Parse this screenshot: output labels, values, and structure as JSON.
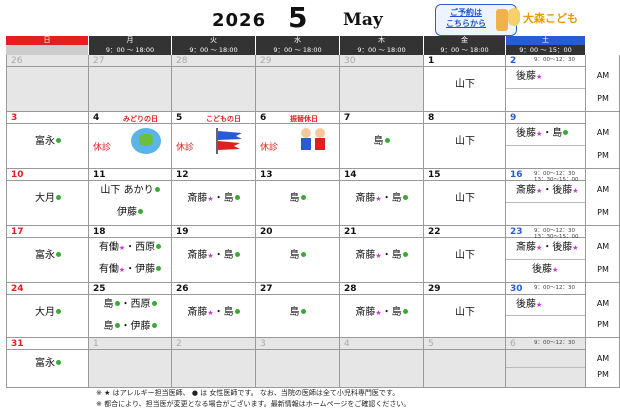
{
  "header": {
    "year": "2026",
    "month_num": "5",
    "month_name": "May",
    "reserve_text": "ご予約は\nこちらから",
    "logo_text": "大森こども"
  },
  "days": [
    "日",
    "月",
    "火",
    "水",
    "木",
    "金",
    "土"
  ],
  "times": [
    "",
    "9：00 ～ 18:00",
    "9：00 ～ 18:00",
    "9：00 ～ 18:00",
    "9：00 ～ 18:00",
    "9：00 ～ 18:00",
    "9：00 ～ 15：00"
  ],
  "ampm": {
    "am": "AM",
    "pm": "PM"
  },
  "weeks": [
    {
      "dates": [
        "26",
        "27",
        "28",
        "29",
        "30",
        "1",
        "2"
      ],
      "grey": [
        1,
        1,
        1,
        1,
        1,
        0,
        0
      ],
      "am": [
        "",
        "",
        "",
        "",
        "",
        "山下",
        ""
      ],
      "pm": [
        "",
        "",
        "",
        "",
        "",
        "",
        ""
      ],
      "sat_am": "後藤",
      "sat_pm": ""
    },
    {
      "dates": [
        "3",
        "4",
        "5",
        "6",
        "7",
        "8",
        "9"
      ],
      "grey": [
        0,
        0,
        0,
        0,
        0,
        0,
        0
      ],
      "am": [
        "富永",
        "",
        "",
        "",
        "島",
        "山下",
        ""
      ],
      "pm": [
        "",
        "",
        "",
        "",
        "",
        "",
        ""
      ],
      "sat_am": "後藤・島",
      "sat_pm": ""
    },
    {
      "dates": [
        "10",
        "11",
        "12",
        "13",
        "14",
        "15",
        "16"
      ],
      "grey": [
        0,
        0,
        0,
        0,
        0,
        0,
        0
      ],
      "am": [
        "大月",
        "山下 あかり",
        "斎藤・島",
        "島",
        "斎藤・島",
        "山下",
        ""
      ],
      "pm": [
        "",
        "伊藤",
        "",
        "",
        "",
        "",
        ""
      ],
      "sat_am": "斎藤・後藤",
      "sat_pm": ""
    },
    {
      "dates": [
        "17",
        "18",
        "19",
        "20",
        "21",
        "22",
        "23"
      ],
      "grey": [
        0,
        0,
        0,
        0,
        0,
        0,
        0
      ],
      "am": [
        "富永",
        "有働・西原",
        "斎藤・島",
        "島",
        "斎藤・島",
        "山下",
        ""
      ],
      "pm": [
        "",
        "有働・伊藤",
        "",
        "",
        "",
        "",
        ""
      ],
      "sat_am": "斎藤・後藤",
      "sat_pm": "後藤"
    },
    {
      "dates": [
        "24",
        "25",
        "26",
        "27",
        "28",
        "29",
        "30"
      ],
      "grey": [
        0,
        0,
        0,
        0,
        0,
        0,
        0
      ],
      "am": [
        "大月",
        "島・西原",
        "斎藤・島",
        "島",
        "斎藤・島",
        "山下",
        ""
      ],
      "pm": [
        "",
        "島・伊藤",
        "",
        "",
        "",
        "",
        ""
      ],
      "sat_am": "後藤",
      "sat_pm": ""
    },
    {
      "dates": [
        "31",
        "1",
        "2",
        "3",
        "4",
        "5",
        "6"
      ],
      "grey": [
        0,
        1,
        1,
        1,
        1,
        1,
        1
      ],
      "am": [
        "富永",
        "",
        "",
        "",
        "",
        "",
        ""
      ],
      "pm": [
        "",
        "",
        "",
        "",
        "",
        "",
        ""
      ],
      "sat_am": "",
      "sat_pm": ""
    }
  ],
  "holidays": {
    "d4": "みどりの日",
    "d5": "こどもの日",
    "d6": "振替休日",
    "closed": "休診"
  },
  "sat_times": {
    "w1": "9：00～12：30",
    "w3": "9：00～12：30\n13：30～15：00",
    "w4": "9：00～12：30\n13：30～15：00",
    "w5": "9：00～12：30",
    "w6": "9：00～12：30"
  },
  "footer": {
    "line1": "※ ★ はアレルギー担当医師、 ● は 女性医師です。 なお、当院の医師は全て小児科専門医です。",
    "line2": "※ 都合により、担当医が変更となる場合がございます。最新情報はホームページをご確認ください。"
  },
  "colors": {
    "sunday": "#e02020",
    "saturday": "#2a5bd7",
    "allergy_star": "#c23bd4",
    "female_dot": "#3aaa35"
  }
}
